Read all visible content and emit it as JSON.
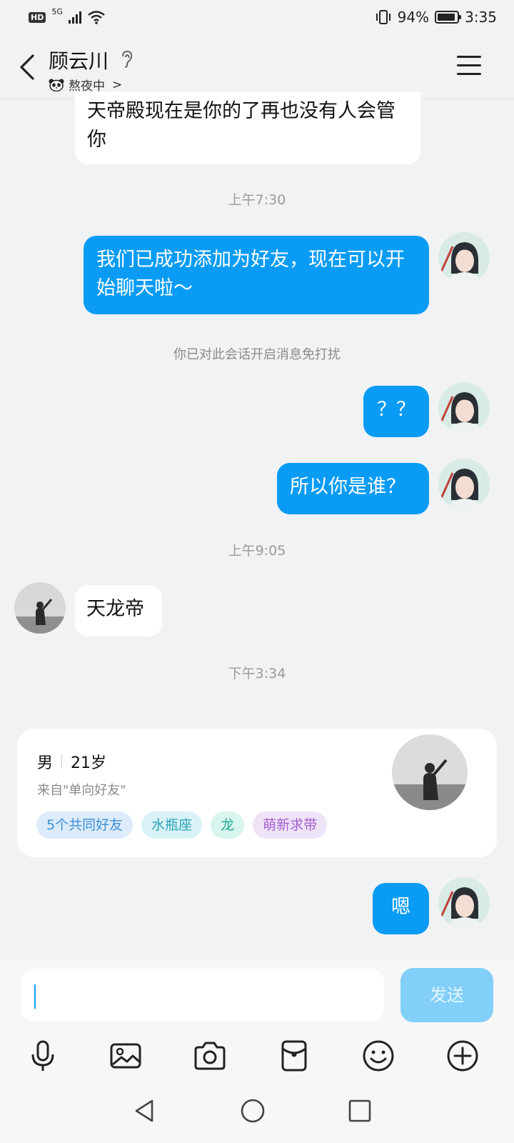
{
  "status_bar": {
    "network": "5G",
    "hd": "HD",
    "battery_pct": "94%",
    "time": "3:35"
  },
  "header": {
    "contact_name": "顾云川",
    "status_text": "熬夜中",
    "status_chevron": ">"
  },
  "messages": {
    "in_1": "天帝殿现在是你的了再也没有人会管你",
    "time_1": "上午7:30",
    "out_1": "我们已成功添加为好友，现在可以开始聊天啦～",
    "system_1": "你已对此会话开启消息免打扰",
    "out_2": "？？",
    "out_3": "所以你是谁？",
    "time_2": "上午9:05",
    "in_2": "天龙帝",
    "time_3": "下午3:34",
    "out_4": "嗯"
  },
  "profile_card": {
    "gender": "男",
    "age": "21岁",
    "source": "来自\"单向好友\"",
    "tags": [
      "5个共同好友",
      "水瓶座",
      "龙",
      "萌新求带"
    ]
  },
  "input": {
    "value": "",
    "send_label": "发送"
  },
  "colors": {
    "accent": "#0a9cf5",
    "send_disabled": "#82cff9"
  }
}
